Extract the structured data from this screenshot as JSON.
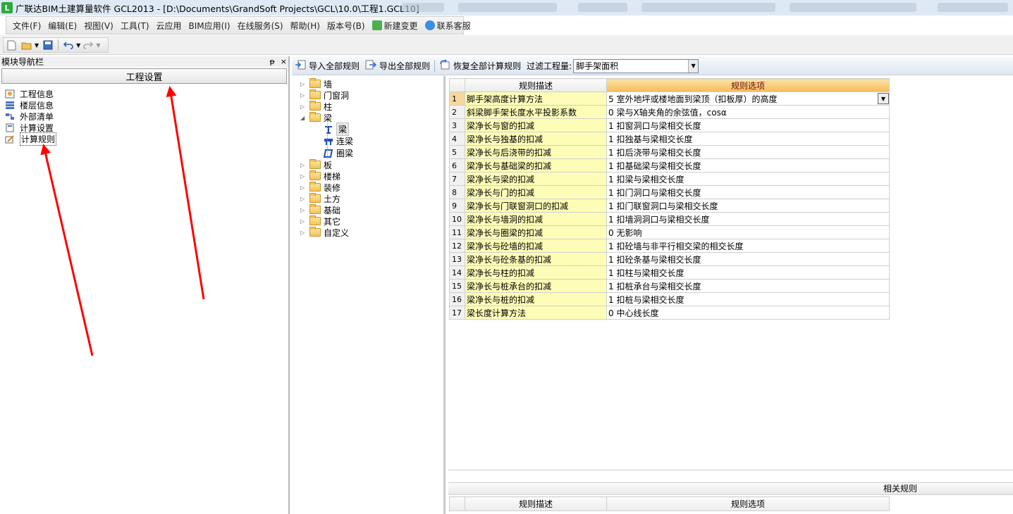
{
  "window": {
    "app_icon_text": "L",
    "title": "广联达BIM土建算量软件 GCL2013 - [D:\\Documents\\GrandSoft Projects\\GCL\\10.0\\工程1.GCL10]"
  },
  "menu": {
    "items": [
      {
        "label": "文件(F)"
      },
      {
        "label": "编辑(E)"
      },
      {
        "label": "视图(V)"
      },
      {
        "label": "工具(T)"
      },
      {
        "label": "云应用"
      },
      {
        "label": "BIM应用(I)"
      },
      {
        "label": "在线服务(S)"
      },
      {
        "label": "帮助(H)"
      },
      {
        "label": "版本号(B)"
      },
      {
        "label": "新建变更",
        "icon": "new-change-icon"
      },
      {
        "label": "联系客服",
        "icon": "customer-service-icon"
      }
    ]
  },
  "toolbar": {
    "buttons": [
      "new-file-icon",
      "open-folder-icon",
      "save-icon",
      "undo-icon",
      "redo-icon"
    ]
  },
  "nav": {
    "header": "模块导航栏",
    "pin_glyph": "ᵽ",
    "close_glyph": "×",
    "section": "工程设置",
    "items": [
      {
        "label": "工程信息",
        "icon": "project-info-icon"
      },
      {
        "label": "楼层信息",
        "icon": "floor-info-icon"
      },
      {
        "label": "外部清单",
        "icon": "external-list-icon"
      },
      {
        "label": "计算设置",
        "icon": "calc-settings-icon"
      },
      {
        "label": "计算规则",
        "icon": "calc-rules-icon",
        "selected": true
      }
    ]
  },
  "rule_toolbar": {
    "import_all": "导入全部规则",
    "export_all": "导出全部规则",
    "restore_all": "恢复全部计算规则",
    "filter_label": "过滤工程量:",
    "filter_value": "脚手架面积"
  },
  "tree": {
    "nodes": [
      {
        "label": "墙",
        "expanded": false
      },
      {
        "label": "门窗洞",
        "expanded": false
      },
      {
        "label": "柱",
        "expanded": false
      },
      {
        "label": "梁",
        "expanded": true,
        "children": [
          {
            "label": "梁",
            "selected": true,
            "icon": "beam-icon"
          },
          {
            "label": "连梁",
            "icon": "link-beam-icon"
          },
          {
            "label": "圈梁",
            "icon": "ring-beam-icon"
          }
        ]
      },
      {
        "label": "板",
        "expanded": false
      },
      {
        "label": "楼梯",
        "expanded": false
      },
      {
        "label": "装修",
        "expanded": false
      },
      {
        "label": "土方",
        "expanded": false
      },
      {
        "label": "基础",
        "expanded": false
      },
      {
        "label": "其它",
        "expanded": false
      },
      {
        "label": "自定义",
        "expanded": false
      }
    ]
  },
  "rules_table": {
    "col_desc": "规则描述",
    "col_option": "规则选项",
    "rows": [
      {
        "num": "1",
        "desc": "脚手架高度计算方法",
        "option": "5 室外地坪或楼地面到梁顶（扣板厚）的高度"
      },
      {
        "num": "2",
        "desc": "斜梁脚手架长度水平投影系数",
        "option": "0 梁与X轴夹角的余弦值，cosα"
      },
      {
        "num": "3",
        "desc": "梁净长与窗的扣减",
        "option": "1 扣窗洞口与梁相交长度"
      },
      {
        "num": "4",
        "desc": "梁净长与独基的扣减",
        "option": "1 扣独基与梁相交长度"
      },
      {
        "num": "5",
        "desc": "梁净长与后浇带的扣减",
        "option": "1 扣后浇带与梁相交长度"
      },
      {
        "num": "6",
        "desc": "梁净长与基础梁的扣减",
        "option": "1 扣基础梁与梁相交长度"
      },
      {
        "num": "7",
        "desc": "梁净长与梁的扣减",
        "option": "1 扣梁与梁相交长度"
      },
      {
        "num": "8",
        "desc": "梁净长与门的扣减",
        "option": "1 扣门洞口与梁相交长度"
      },
      {
        "num": "9",
        "desc": "梁净长与门联窗洞口的扣减",
        "option": "1 扣门联窗洞口与梁相交长度"
      },
      {
        "num": "10",
        "desc": "梁净长与墙洞的扣减",
        "option": "1 扣墙洞洞口与梁相交长度"
      },
      {
        "num": "11",
        "desc": "梁净长与圈梁的扣减",
        "option": "0  无影响"
      },
      {
        "num": "12",
        "desc": "梁净长与砼墙的扣减",
        "option": "1 扣砼墙与非平行相交梁的相交长度"
      },
      {
        "num": "13",
        "desc": "梁净长与砼条基的扣减",
        "option": "1 扣砼条基与梁相交长度"
      },
      {
        "num": "14",
        "desc": "梁净长与柱的扣减",
        "option": "1 扣柱与梁相交长度"
      },
      {
        "num": "15",
        "desc": "梁净长与桩承台的扣减",
        "option": "1 扣桩承台与梁相交长度"
      },
      {
        "num": "16",
        "desc": "梁净长与桩的扣减",
        "option": "1 扣桩与梁相交长度"
      },
      {
        "num": "17",
        "desc": "梁长度计算方法",
        "option": "0 中心线长度"
      }
    ]
  },
  "related": {
    "title": "相关规则",
    "col_desc": "规则描述",
    "col_option": "规则选项"
  },
  "annotations": {
    "arrow_color": "#ff0000"
  }
}
